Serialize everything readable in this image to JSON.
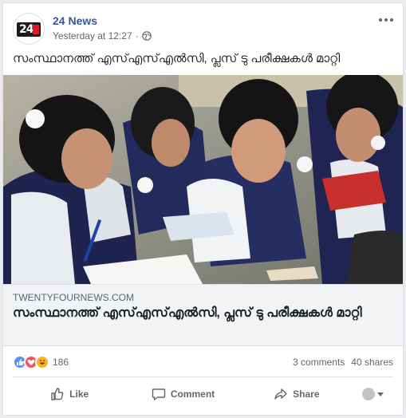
{
  "post": {
    "page_name": "24 News",
    "timestamp": "Yesterday at 12:27",
    "separator": "·",
    "text": "സംസ്ഥാനത്ത് എസ്എസ്എൽസി, പ്ലസ് ടു പരീക്ഷകൾ മാറ്റി",
    "avatar_logo": "24",
    "avatar_logo_color": "#e11a22"
  },
  "link_preview": {
    "domain": "TWENTYFOURNEWS.COM",
    "title": "സംസ്ഥാനത്ത് എസ്എസ്എൽസി, പ്ലസ് ടു പരീക്ഷകൾ മാറ്റി"
  },
  "engagement": {
    "reaction_icons": [
      "like-icon",
      "love-icon",
      "haha-icon"
    ],
    "reaction_count": "186",
    "comments": "3 comments",
    "shares": "40 shares"
  },
  "actions": {
    "like_label": "Like",
    "comment_label": "Comment",
    "share_label": "Share"
  },
  "colors": {
    "link_blue": "#365899",
    "like_blue": "#5890ff",
    "love_red": "#f25268",
    "haha_yellow": "#f7b125"
  }
}
